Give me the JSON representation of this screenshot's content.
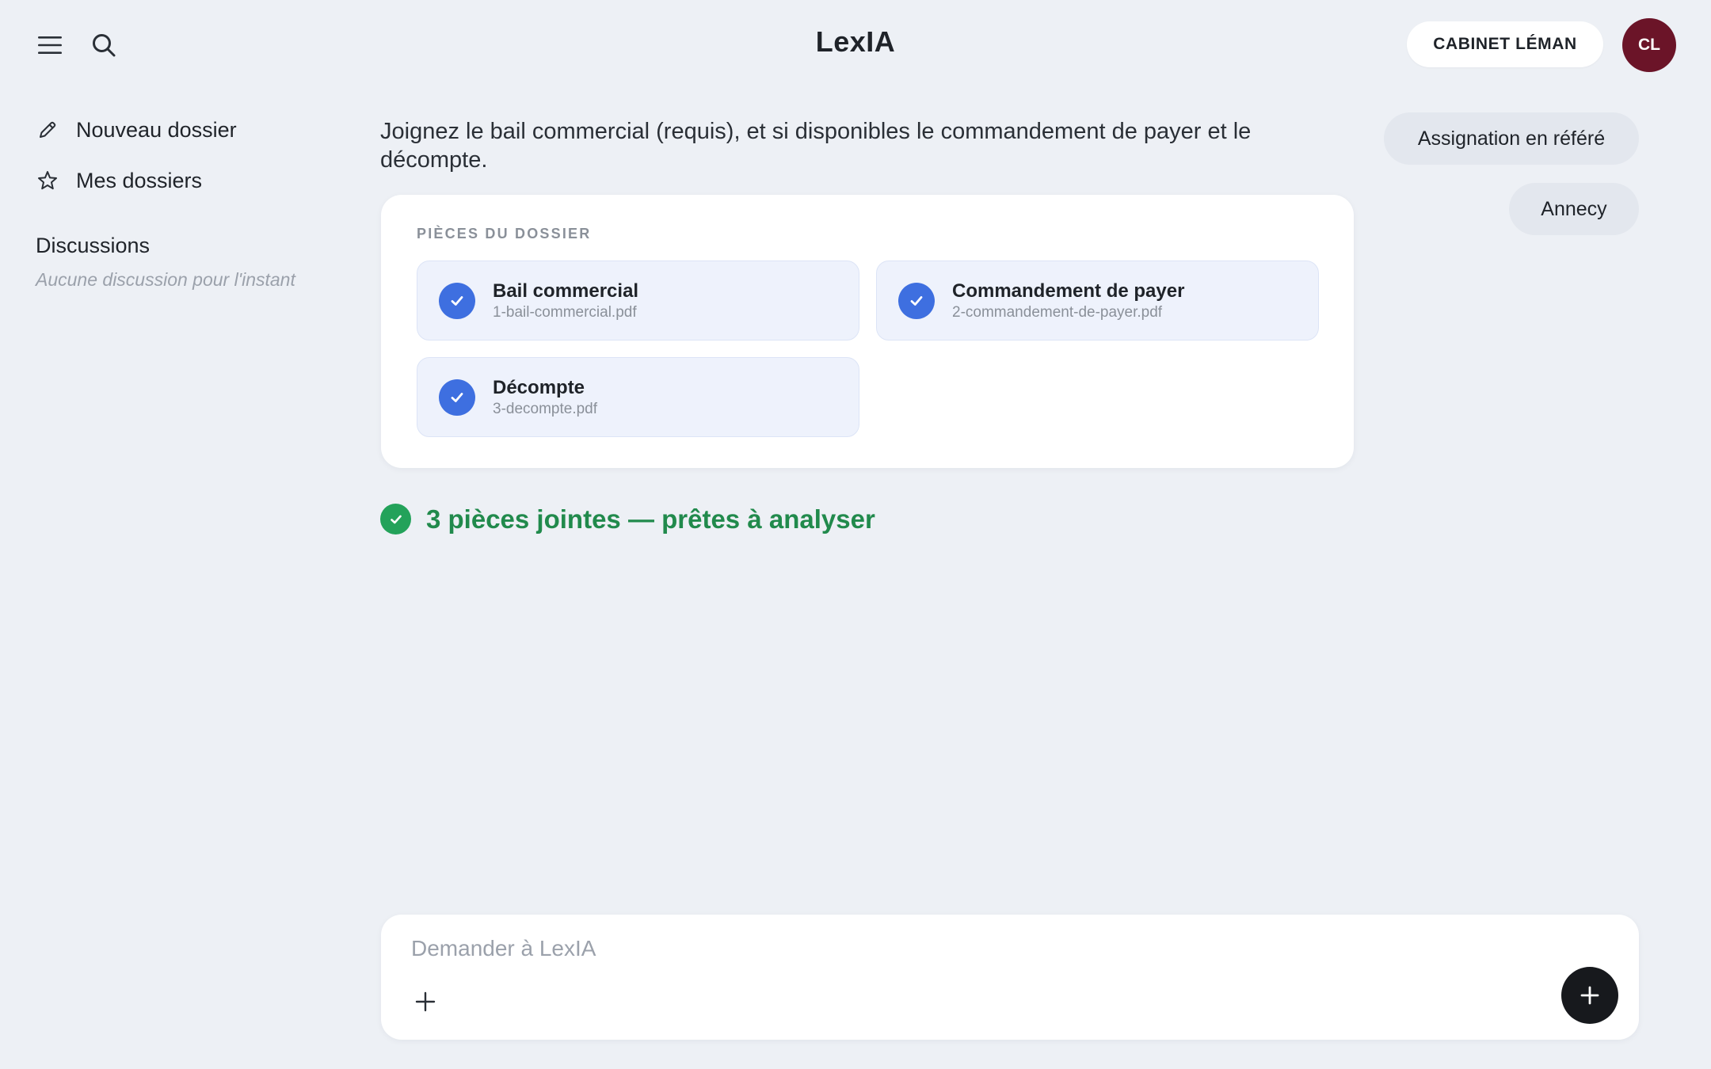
{
  "app": {
    "title": "LexIA"
  },
  "header": {
    "org_label": "CABINET LÉMAN",
    "avatar_initials": "CL",
    "menu_icon": "hamburger-menu-icon",
    "search_icon": "search-icon"
  },
  "sidebar": {
    "items": [
      {
        "label": "Nouveau dossier",
        "icon": "pencil-icon"
      },
      {
        "label": "Mes dossiers",
        "icon": "star-icon"
      }
    ],
    "discussions_title": "Discussions",
    "discussions_empty": "Aucune discussion pour l'instant"
  },
  "main": {
    "prompt": "Joignez le bail commercial (requis), et si disponibles le commandement de payer et le décompte.",
    "card": {
      "label": "PIÈCES DU DOSSIER",
      "files": [
        {
          "name": "Bail commercial",
          "file": "1-bail-commercial.pdf"
        },
        {
          "name": "Commandement de payer",
          "file": "2-commandement-de-payer.pdf"
        },
        {
          "name": "Décompte",
          "file": "3-decompte.pdf"
        }
      ]
    },
    "status": "3 pièces jointes — prêtes à analyser"
  },
  "suggestions": [
    "Assignation en référé",
    "Annecy"
  ],
  "composer": {
    "placeholder": "Demander à LexIA"
  },
  "colors": {
    "background": "#edf0f5",
    "accent_blue": "#3e6fe0",
    "success_green": "#23a25a",
    "avatar": "#6b1428",
    "send_button": "#17191d"
  }
}
